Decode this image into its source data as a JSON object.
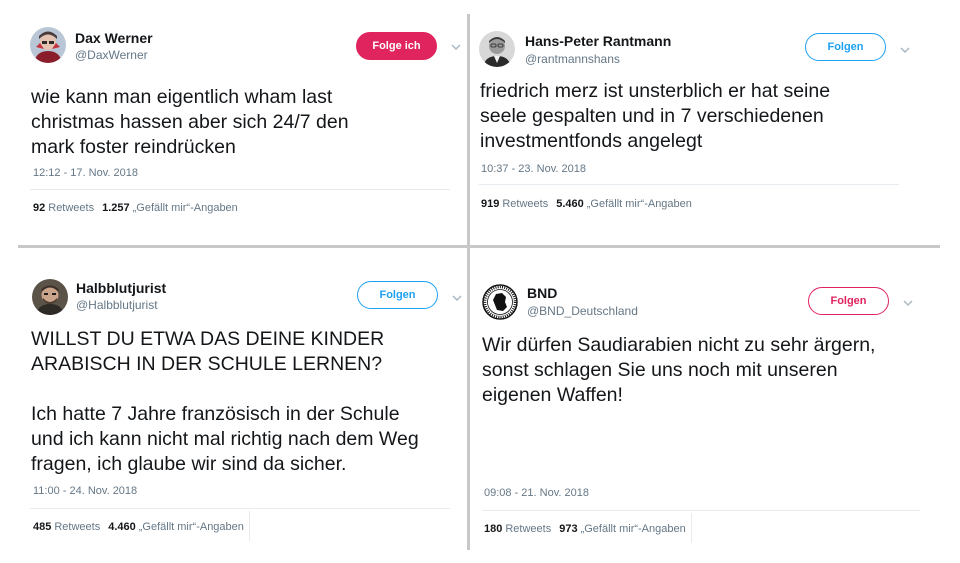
{
  "tweets": [
    {
      "name": "Dax Werner",
      "handle": "@DaxWerner",
      "follow_label": "Folge ich",
      "text": "wie kann man eigentlich wham last\nchristmas hassen aber sich 24/7 den\nmark foster reindrücken",
      "time": "12:12 - 17. Nov. 2018",
      "retweets_count": "92",
      "retweets_label": "Retweets",
      "likes_count": "1.257",
      "likes_label": "„Gefällt mir“-Angaben"
    },
    {
      "name": "Hans-Peter Rantmann",
      "handle": "@rantmannshans",
      "follow_label": "Folgen",
      "text": "friedrich merz ist unsterblich er hat seine\nseele gespalten und in 7 verschiedenen\ninvestmentfonds angelegt",
      "time": "10:37 - 23. Nov. 2018",
      "retweets_count": "919",
      "retweets_label": "Retweets",
      "likes_count": "5.460",
      "likes_label": "„Gefällt mir“-Angaben"
    },
    {
      "name": "Halbblutjurist",
      "handle": "@Halbblutjurist",
      "follow_label": "Folgen",
      "text": "WILLST DU ETWA DAS DEINE KINDER\nARABISCH IN DER SCHULE LERNEN?\n\nIch hatte 7 Jahre französisch in der Schule\nund ich kann nicht mal richtig nach dem Weg\nfragen, ich glaube wir sind da sicher.",
      "time": "11:00 - 24. Nov. 2018",
      "retweets_count": "485",
      "retweets_label": "Retweets",
      "likes_count": "4.460",
      "likes_label": "„Gefällt mir“-Angaben"
    },
    {
      "name": "BND",
      "handle": "@BND_Deutschland",
      "follow_label": "Folgen",
      "text": "Wir dürfen Saudiarabien nicht zu sehr ärgern,\nsonst schlagen Sie uns noch mit unseren\neigenen Waffen!",
      "time": "09:08 - 21. Nov. 2018",
      "retweets_count": "180",
      "retweets_label": "Retweets",
      "likes_count": "973",
      "likes_label": "„Gefällt mir“-Angaben"
    }
  ],
  "colors": {
    "twitter_blue": "#1da1f2",
    "follow_red": "#e0245e",
    "secondary_text": "#657786"
  },
  "icons": {
    "menu": "chevron-down-icon"
  }
}
